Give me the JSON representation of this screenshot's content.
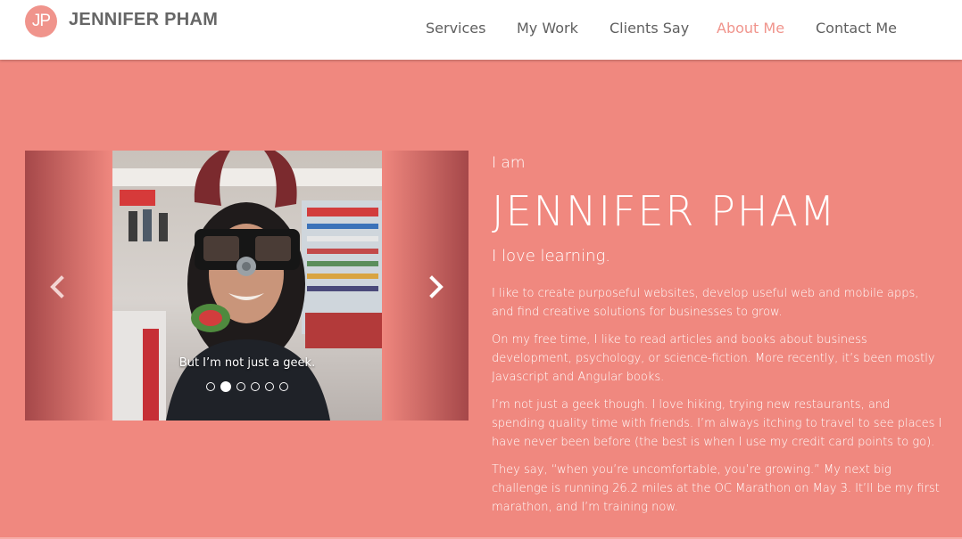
{
  "header": {
    "logo_text": "JP",
    "brand_name": "JENNIFER PHAM",
    "nav": [
      {
        "label": "Services",
        "active": false
      },
      {
        "label": "My Work",
        "active": false
      },
      {
        "label": "Clients Say",
        "active": false
      },
      {
        "label": "About Me",
        "active": true
      },
      {
        "label": "Contact Me",
        "active": false
      }
    ]
  },
  "carousel": {
    "caption": "But I’m not just a geek.",
    "slide_count": 6,
    "active_index": 1,
    "prev_icon": "chevron-left-icon",
    "next_icon": "chevron-right-icon"
  },
  "about": {
    "intro": "I am",
    "name": "JENNIFER PHAM",
    "tagline": "I love learning.",
    "paragraphs": [
      "I like to create purposeful websites, develop useful web and mobile apps, and find creative solutions for businesses to grow.",
      "On my free time, I like to read articles and books about business development, psychology, or science-fiction. More recently, it’s been mostly Javascript and Angular books.",
      "I’m not just a geek though. I love hiking, trying new restaurants, and spending quality time with friends. I’m always itching to travel to see places I have never been before (the best is when I use my credit card points to go).",
      "They say, “when you’re uncomfortable, you’re growing.” My next big challenge is running 26.2 miles at the OC Marathon on May 3. It’ll be my first marathon, and I’m training now."
    ]
  },
  "colors": {
    "accent": "#f0948c",
    "hero_background": "#f0887f",
    "nav_text": "#5f5f5f",
    "brand_text": "#666666"
  }
}
